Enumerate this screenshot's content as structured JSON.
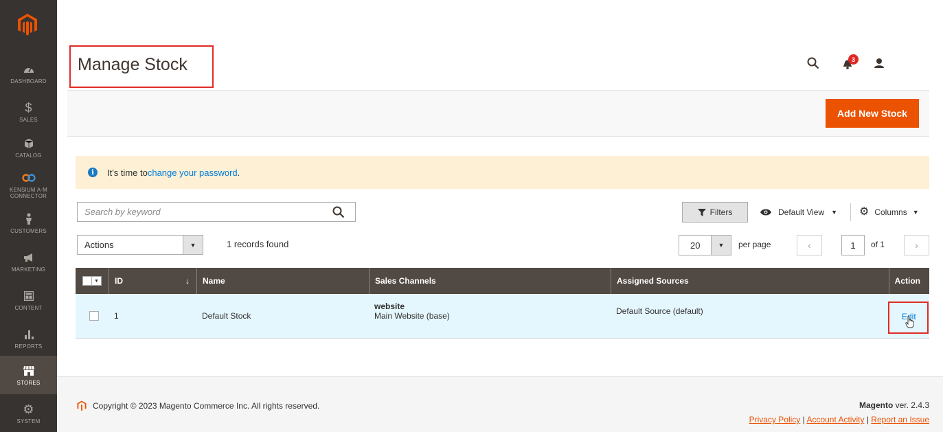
{
  "sidebar": {
    "logo_icon": "magento-logo-icon",
    "items": [
      {
        "label": "DASHBOARD",
        "icon": "dashboard-icon",
        "glyph": "◕"
      },
      {
        "label": "SALES",
        "icon": "dollar-icon",
        "glyph": "$"
      },
      {
        "label": "CATALOG",
        "icon": "cube-icon",
        "glyph": "⬢"
      },
      {
        "label": "KENSIUM A-M CONNECTOR",
        "icon": "infinity-icon",
        "glyph": "∞"
      },
      {
        "label": "CUSTOMERS",
        "icon": "person-icon",
        "glyph": "♟"
      },
      {
        "label": "MARKETING",
        "icon": "megaphone-icon",
        "glyph": "◀"
      },
      {
        "label": "CONTENT",
        "icon": "layout-icon",
        "glyph": "▤"
      },
      {
        "label": "REPORTS",
        "icon": "bar-chart-icon",
        "glyph": "▮"
      },
      {
        "label": "STORES",
        "icon": "store-icon",
        "glyph": "⌂"
      },
      {
        "label": "SYSTEM",
        "icon": "gear-icon",
        "glyph": "⚙"
      }
    ],
    "active": "STORES"
  },
  "header": {
    "title": "Manage Stock",
    "notifications_count": "3",
    "icons": [
      "search-icon",
      "bell-icon",
      "user-icon"
    ]
  },
  "action_bar": {
    "add_button_label": "Add New Stock"
  },
  "message": {
    "prefix": "It's time to ",
    "link": "change your password",
    "suffix": "."
  },
  "toolbar": {
    "search_placeholder": "Search by keyword",
    "search_value": "",
    "filters_label": "Filters",
    "view_label": "Default View",
    "columns_label": "Columns",
    "actions_label": "Actions",
    "records_found": "1 records found",
    "per_page_value": "20",
    "per_page_label": "per page",
    "current_page": "1",
    "of_pages": "of 1"
  },
  "grid": {
    "columns": [
      "ID",
      "Name",
      "Sales Channels",
      "Assigned Sources",
      "Action"
    ],
    "sort_indicator": "↓",
    "rows": [
      {
        "id": "1",
        "name": "Default Stock",
        "channel_title": "website",
        "channel_detail": "Main Website (base)",
        "sources": "Default Source (default)",
        "action": "Edit"
      }
    ]
  },
  "footer": {
    "copyright": "Copyright © 2023 Magento Commerce Inc. All rights reserved.",
    "brand": "Magento",
    "version": " ver. 2.4.3",
    "links": [
      "Privacy Policy",
      "Account Activity",
      "Report an Issue"
    ],
    "separator": " | "
  },
  "colors": {
    "sidebar_bg": "#373330",
    "accent": "#eb5202",
    "grid_header": "#514943",
    "highlight_box": "#e02b27",
    "link": "#007bdb"
  }
}
